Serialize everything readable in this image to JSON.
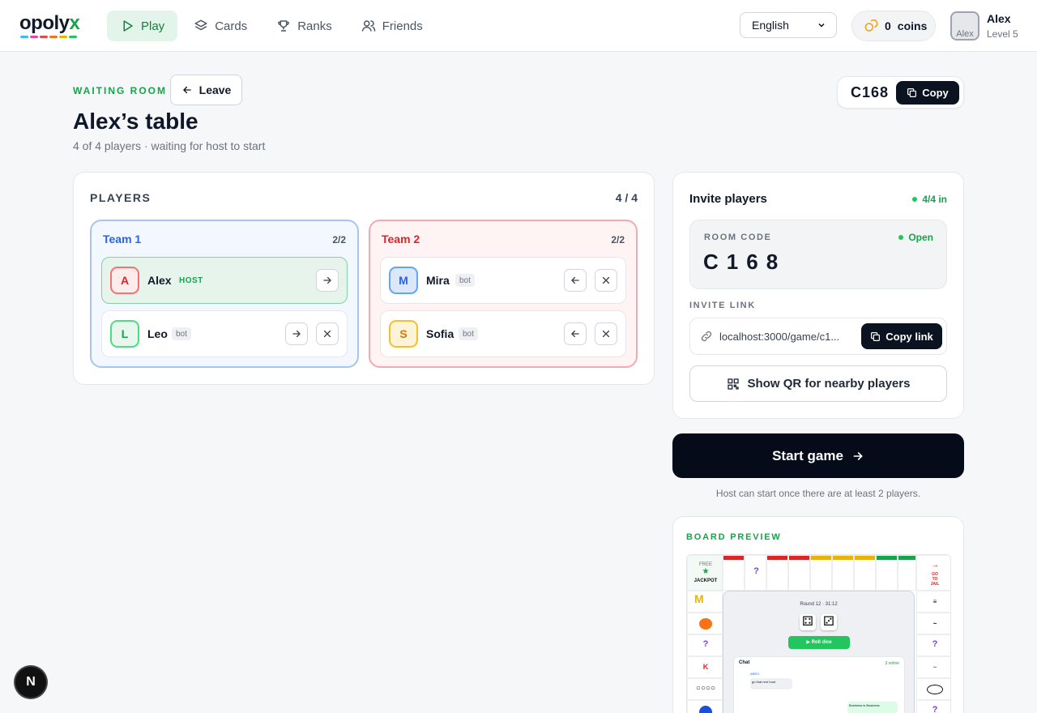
{
  "header": {
    "logo_main": "opoly",
    "logo_accent": "x",
    "logo_stripe_colors": [
      "#38bdf8",
      "#ec4899",
      "#ef4444",
      "#f97316",
      "#eab308",
      "#22c55e"
    ],
    "nav": [
      {
        "label": "Play",
        "icon": "play-icon",
        "active": true
      },
      {
        "label": "Cards",
        "icon": "layers-icon",
        "active": false
      },
      {
        "label": "Ranks",
        "icon": "trophy-icon",
        "active": false
      },
      {
        "label": "Friends",
        "icon": "users-icon",
        "active": false
      }
    ],
    "language": "English",
    "coins_value": "0",
    "coins_label": "coins",
    "avatar_alt": "Alex",
    "user_name": "Alex",
    "user_level": "Level 5"
  },
  "room": {
    "eyebrow": "WAITING ROOM",
    "leave_label": "Leave",
    "title": "Alex’s table",
    "subtitle": "4 of 4 players · waiting for host to start",
    "code": "C168",
    "copy_label": "Copy"
  },
  "players": {
    "label": "PLAYERS",
    "count": "4 / 4",
    "teams": [
      {
        "name": "Team 1",
        "count": "2/2",
        "members": [
          {
            "initial": "A",
            "name": "Alex",
            "tag": "HOST"
          },
          {
            "initial": "L",
            "name": "Leo",
            "tag": "bot"
          }
        ]
      },
      {
        "name": "Team 2",
        "count": "2/2",
        "members": [
          {
            "initial": "M",
            "name": "Mira",
            "tag": "bot"
          },
          {
            "initial": "S",
            "name": "Sofia",
            "tag": "bot"
          }
        ]
      }
    ]
  },
  "invite": {
    "title": "Invite players",
    "status": "4/4 in",
    "room_code_label": "ROOM CODE",
    "room_code_status": "Open",
    "room_code": "C168",
    "invite_link_label": "INVITE LINK",
    "invite_link": "localhost:3000/game/c1...",
    "copy_link_label": "Copy link",
    "qr_label": "Show QR for nearby players"
  },
  "start": {
    "label": "Start game",
    "note": "Host can start once there are at least 2 players."
  },
  "preview": {
    "label": "BOARD PREVIEW",
    "corner_free": "FREE",
    "corner_jackpot": "JACKPOT",
    "corner_jail_1": "GO",
    "corner_jail_2": "TO",
    "corner_jail_3": "JAIL",
    "round": "Round 12 · 31:12",
    "roll": "▶ Roll dice",
    "chat_title": "Chat",
    "chat_status": "3 online",
    "chat_user": "ARES",
    "chat_message_1": "go that rent hunt",
    "chat_message_2": "Business is Business"
  },
  "colors": {
    "accent": "#16a34a",
    "team1": "#2563eb",
    "team2": "#dc2626",
    "primary_button": "#050b18"
  },
  "dev_badge": "N"
}
